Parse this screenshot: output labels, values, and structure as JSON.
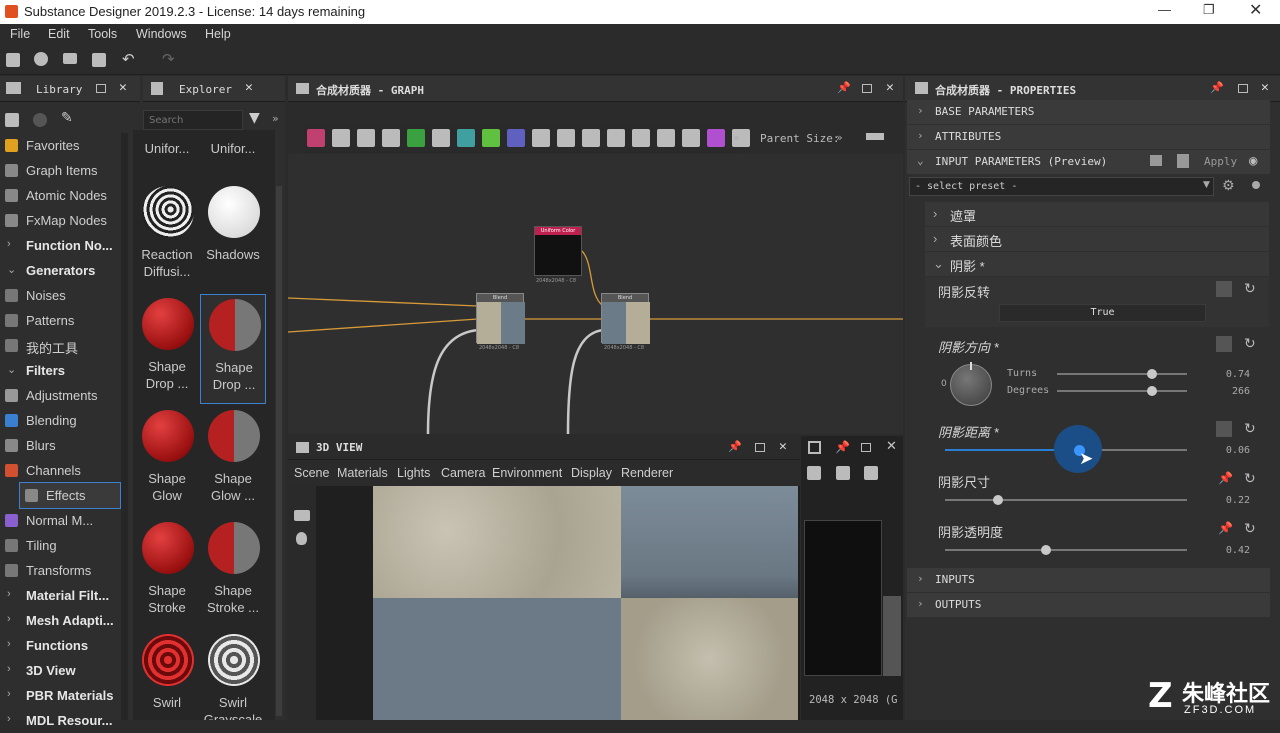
{
  "window": {
    "title": "Substance Designer 2019.2.3 - License: 14 days remaining"
  },
  "menu": [
    "File",
    "Edit",
    "Tools",
    "Windows",
    "Help"
  ],
  "library": {
    "tab_library": "Library",
    "tab_explorer": "Explorer",
    "search_placeholder": "Search",
    "tree": [
      {
        "label": "Favorites",
        "type": "item",
        "icon_color": "#e0a020"
      },
      {
        "label": "Graph Items",
        "type": "item",
        "icon_color": "#888888"
      },
      {
        "label": "Atomic Nodes",
        "type": "item",
        "icon_color": "#888888"
      },
      {
        "label": "FxMap Nodes",
        "type": "item",
        "icon_color": "#888888"
      },
      {
        "label": "Function No...",
        "type": "header",
        "arrow": "›"
      },
      {
        "label": "Generators",
        "type": "header",
        "arrow": "⌄"
      },
      {
        "label": "Noises",
        "type": "item",
        "icon_color": "#777777"
      },
      {
        "label": "Patterns",
        "type": "item",
        "icon_color": "#777777"
      },
      {
        "label": "我的工具",
        "type": "item",
        "icon_color": "#777777"
      },
      {
        "label": "Filters",
        "type": "header",
        "arrow": "⌄"
      },
      {
        "label": "Adjustments",
        "type": "item",
        "icon_color": "#999999"
      },
      {
        "label": "Blending",
        "type": "item",
        "icon_color": "#3a7fd0"
      },
      {
        "label": "Blurs",
        "type": "item",
        "icon_color": "#888888"
      },
      {
        "label": "Channels",
        "type": "item",
        "icon_color": "#d05030"
      },
      {
        "label": "Effects",
        "type": "item",
        "icon_color": "#888888",
        "selected": true
      },
      {
        "label": "Normal M...",
        "type": "item",
        "icon_color": "#8a60d0"
      },
      {
        "label": "Tiling",
        "type": "item",
        "icon_color": "#777777"
      },
      {
        "label": "Transforms",
        "type": "item",
        "icon_color": "#777777"
      },
      {
        "label": "Material Filt...",
        "type": "header",
        "arrow": "›"
      },
      {
        "label": "Mesh Adapti...",
        "type": "header",
        "arrow": "›"
      },
      {
        "label": "Functions",
        "type": "header",
        "arrow": "›"
      },
      {
        "label": "3D View",
        "type": "header",
        "arrow": "›"
      },
      {
        "label": "PBR Materials",
        "type": "header",
        "arrow": "›"
      },
      {
        "label": "MDL Resour...",
        "type": "header",
        "arrow": "›"
      }
    ],
    "thumbs": [
      {
        "label": "Unifor...",
        "style": "none"
      },
      {
        "label": "Unifor...",
        "style": "none"
      },
      {
        "label": "Reaction Diffusi...",
        "style": "zebra"
      },
      {
        "label": "Shadows",
        "style": "white"
      },
      {
        "label": "Shape Drop ...",
        "style": "red"
      },
      {
        "label": "Shape Drop ...",
        "style": "redhalf",
        "selected": true
      },
      {
        "label": "Shape Glow",
        "style": "red"
      },
      {
        "label": "Shape Glow ...",
        "style": "redhalf"
      },
      {
        "label": "Shape Stroke",
        "style": "red"
      },
      {
        "label": "Shape Stroke ...",
        "style": "redhalf"
      },
      {
        "label": "Swirl",
        "style": "swirlred"
      },
      {
        "label": "Swirl Grayscale",
        "style": "swirlgray"
      }
    ]
  },
  "graph": {
    "title": "合成材质器 - GRAPH",
    "parent_size_label": "Parent Size:",
    "nodes": [
      {
        "title": "Uniform Color",
        "info": "2048x2048 - C8"
      },
      {
        "title": "Blend",
        "info": "2048x2048 - C8"
      },
      {
        "title": "Blend",
        "info": "2048x2048 - C8"
      }
    ]
  },
  "view3d": {
    "title": "3D VIEW",
    "menu": [
      "Scene",
      "Materials",
      "Lights",
      "Camera",
      "Environment",
      "Display",
      "Renderer"
    ],
    "resolution": "2048 x 2048 (G"
  },
  "properties": {
    "title": "合成材质器 - PROPERTIES",
    "sections": [
      "BASE PARAMETERS",
      "ATTRIBUTES"
    ],
    "input_params": "INPUT PARAMETERS (Preview)",
    "apply": "Apply",
    "preset": "- select preset -",
    "groups": [
      "遮罩",
      "表面颜色",
      "阴影 *"
    ],
    "params": {
      "invert_label": "阴影反转",
      "invert_value": "True",
      "dir_label": "阴影方向 *",
      "turns_label": "Turns",
      "turns_value": "0.74",
      "degrees_label": "Degrees",
      "degrees_value": "266",
      "dir_zero": "0",
      "dist_label": "阴影距离 *",
      "dist_value": "0.06",
      "size_label": "阴影尺寸",
      "size_value": "0.22",
      "opacity_label": "阴影透明度",
      "opacity_value": "0.42"
    },
    "bottom_sections": [
      "INPUTS",
      "OUTPUTS"
    ]
  },
  "watermark": {
    "brand": "朱峰社区",
    "url": "ZF3D.COM"
  }
}
